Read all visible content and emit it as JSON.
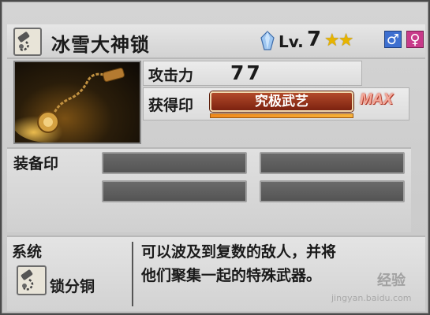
{
  "header": {
    "title": "冰雪大神锁",
    "level_label": "Lv.",
    "level_value": "7",
    "stars": "★★",
    "male_symbol": "♂",
    "female_symbol": "♀"
  },
  "stats": {
    "attack_label": "攻击力",
    "attack_value": "77",
    "seal_label": "获得印",
    "seal_name": "究极武艺",
    "seal_max": "MAX",
    "seal_progress": 1.0
  },
  "equip": {
    "label": "装备印",
    "slots": [
      "",
      "",
      "",
      ""
    ]
  },
  "system": {
    "label": "系统",
    "type_name": "锁分铜",
    "description_line1": "可以波及到复数的敌人，并将",
    "description_line2": "他们聚集一起的特殊武器。"
  },
  "watermark": {
    "brand": "经验",
    "url": "jingyan.baidu.com"
  },
  "colors": {
    "seal_badge": "#9a3418",
    "seal_bar": "#f39a2a",
    "max": "#f3a99a",
    "stars": "#e7b400",
    "male": "#3d6fd0",
    "female": "#c83a8a"
  },
  "icons": {
    "weapon_icon": "chain-weapon-icon",
    "crystal_icon": "crystal-icon",
    "system_icon": "chain-weapon-icon"
  }
}
